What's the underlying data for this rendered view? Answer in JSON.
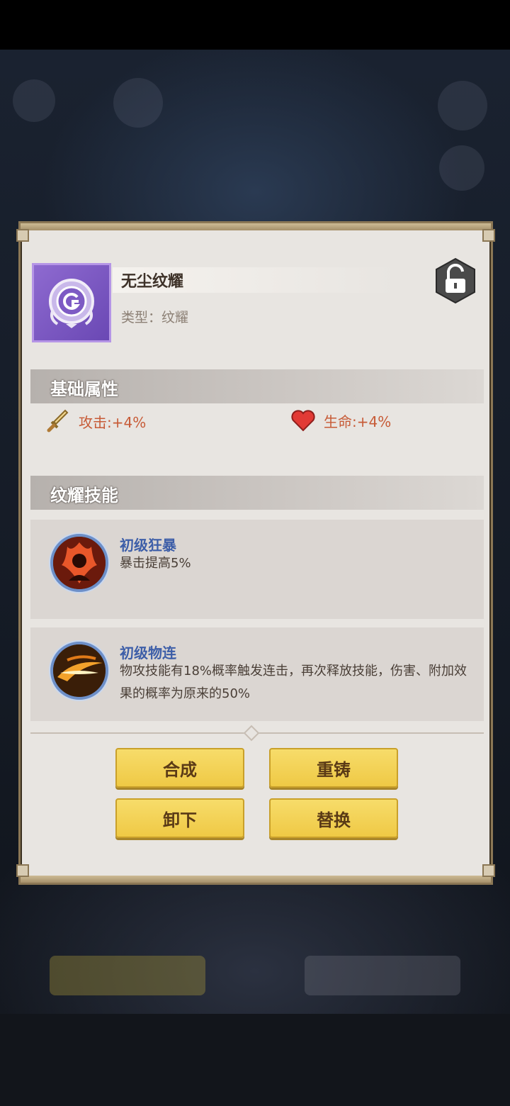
{
  "item": {
    "name": "无尘纹耀",
    "type_label": "类型：纹耀"
  },
  "sections": {
    "base_attributes": "基础属性",
    "skills": "纹耀技能"
  },
  "stats": {
    "attack": "攻击:+4%",
    "health": "生命:+4%"
  },
  "skills": [
    {
      "name": "初级狂暴",
      "desc": "暴击提高5%"
    },
    {
      "name": "初级物连",
      "desc": "物攻技能有18%概率触发连击，再次释放技能，伤害、附加效果的概率为原来的50%"
    }
  ],
  "buttons": {
    "synthesize": "合成",
    "reforge": "重铸",
    "unequip": "卸下",
    "replace": "替换"
  },
  "colors": {
    "accent_button": "#efc945",
    "item_quality": "#8e6ad0",
    "skill_name": "#3d5ea8",
    "stat_text": "#c75b37"
  }
}
